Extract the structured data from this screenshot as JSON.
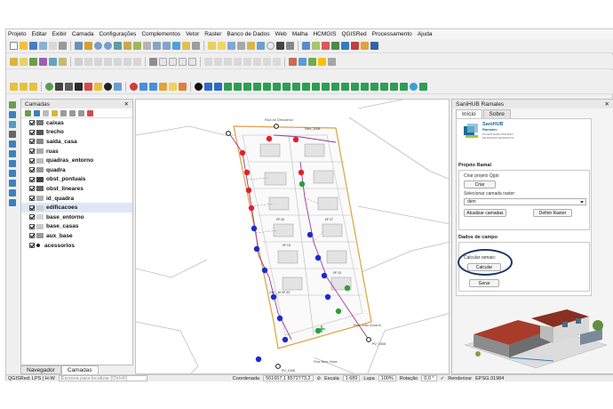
{
  "menu": [
    "Projeto",
    "Editar",
    "Exibir",
    "Camada",
    "Configurações",
    "Complementos",
    "Vetor",
    "Raster",
    "Banco de Dados",
    "Web",
    "Malha",
    "HCMGIS",
    "QGISRed",
    "Processamento",
    "Ajuda"
  ],
  "layers_panel": {
    "title": "Camadas",
    "items": [
      {
        "name": "caixas",
        "symbol": "#777777"
      },
      {
        "name": "trecho",
        "symbol": "#555555"
      },
      {
        "name": "saida_casa",
        "symbol": "#888888"
      },
      {
        "name": "ruas",
        "symbol": "#aaaaaa"
      },
      {
        "name": "quadras_entorno",
        "symbol": "#bbbbbb"
      },
      {
        "name": "quadra",
        "symbol": "#999999"
      },
      {
        "name": "obst_pontuais",
        "symbol": "#444444"
      },
      {
        "name": "obst_lineares",
        "symbol": "#666666"
      },
      {
        "name": "id_quadra",
        "symbol": "#b0b0b0"
      },
      {
        "name": "edificacoes",
        "symbol": "#cfcfcf"
      },
      {
        "name": "base_entorno",
        "symbol": "#d5d5d5"
      },
      {
        "name": "base_casas",
        "symbol": "#c8c8c8"
      },
      {
        "name": "aux_base",
        "symbol": "#9a9a9a"
      },
      {
        "name": "acessorios",
        "symbol": "#222222"
      }
    ],
    "tabs": [
      "Navegador",
      "Camadas"
    ]
  },
  "map": {
    "street_labels": [
      "Rua do Descanso",
      "Rua João Amaral",
      "Rua Bela Vista"
    ],
    "point_labels": [
      "PV_1008",
      "PV_1006",
      "Sem_1008"
    ],
    "lot_labels": [
      "CDL_10 Nº 33",
      "Nº 25",
      "Nº 19",
      "Nº 27",
      "Nº 15"
    ]
  },
  "sanihub": {
    "title": "SaniHUB Ramales",
    "tabs": [
      "Início",
      "Sobre"
    ],
    "logo_name": "SaniHUB",
    "logo_subtitle": "Ramales",
    "logo_tagline": "PLUGIN PARA PROJETO DE RAMAIS DE ESGOTO",
    "section_project": "Projeto Ramal",
    "create_project_label": "Criar projeto Qgis:",
    "create_button": "Criar",
    "select_raster_label": "Selecionar camada raster:",
    "raster_value": "dem",
    "update_layers_button": "Atualizar camadas",
    "set_raster_button": "Definir Raster",
    "section_field_data": "Dados de campo",
    "calc_label": "Calcular ramais:",
    "calc_button": "Calcular",
    "generate_button": "Gerar"
  },
  "status": {
    "qgisred": "QGISRed: LPS | H-W",
    "search_placeholder": "Escreva para localizar (Ctrl+K)",
    "coord_label": "Coordenada",
    "coord_value": "561657,1 8572773,2",
    "scale_label": "Escala",
    "scale_value": "1:689",
    "zoom_label": "Lupa",
    "zoom_value": "100%",
    "rotation_label": "Rotação",
    "rotation_value": "0,0 °",
    "render_label": "Renderizar",
    "epsg": "EPSG:31984"
  },
  "colors": {
    "manhole_red": "#e0212c",
    "manhole_blue": "#1a2bd0",
    "manhole_green": "#2e9e3a",
    "highlight": "#1b3764"
  }
}
